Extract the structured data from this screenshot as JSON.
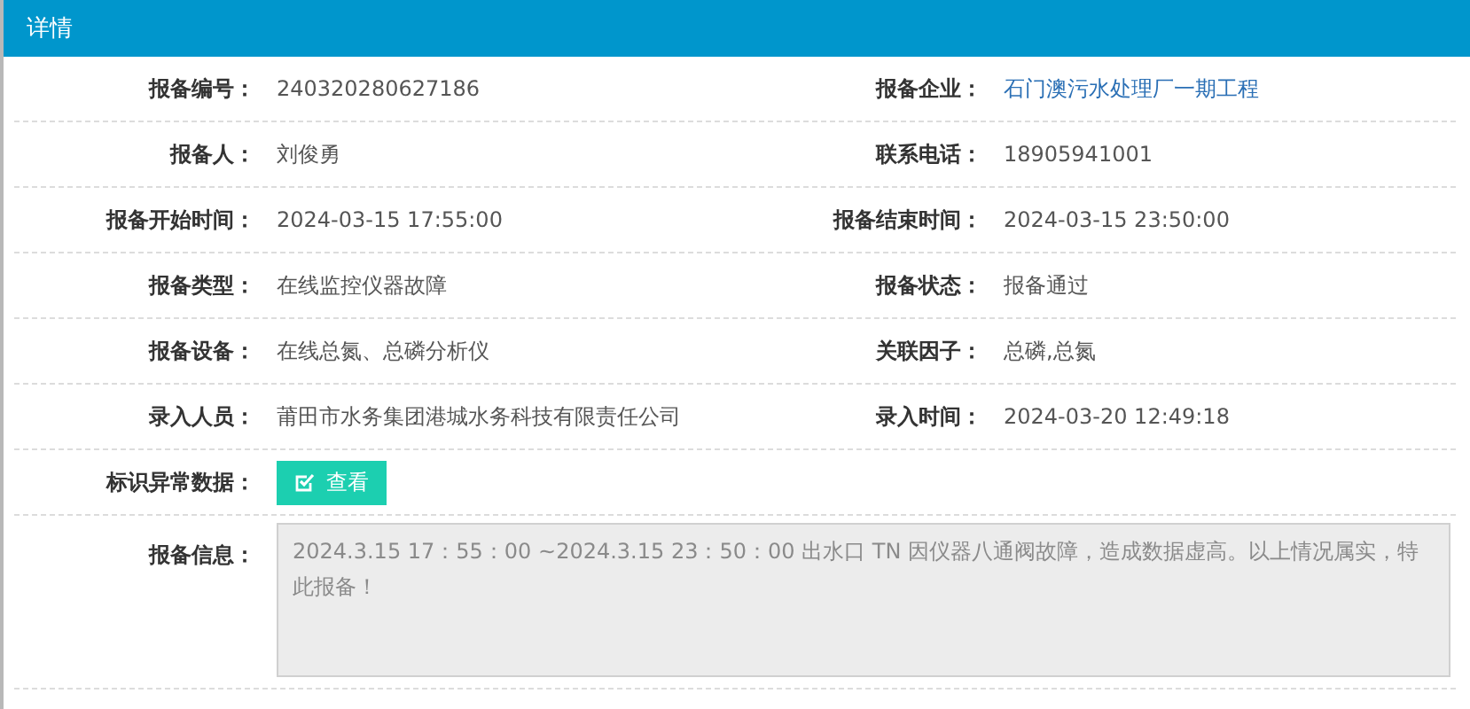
{
  "window": {
    "title": "详情"
  },
  "rows": [
    [
      {
        "label": "报备编号：",
        "value": "240320280627186",
        "kind": "text"
      },
      {
        "label": "报备企业：",
        "value": "石门澳污水处理厂一期工程",
        "kind": "link"
      }
    ],
    [
      {
        "label": "报备人：",
        "value": "刘俊勇",
        "kind": "text"
      },
      {
        "label": "联系电话：",
        "value": "18905941001",
        "kind": "text"
      }
    ],
    [
      {
        "label": "报备开始时间：",
        "value": "2024-03-15 17:55:00",
        "kind": "text"
      },
      {
        "label": "报备结束时间：",
        "value": "2024-03-15 23:50:00",
        "kind": "text"
      }
    ],
    [
      {
        "label": "报备类型：",
        "value": "在线监控仪器故障",
        "kind": "text"
      },
      {
        "label": "报备状态：",
        "value": "报备通过",
        "kind": "text"
      }
    ],
    [
      {
        "label": "报备设备：",
        "value": "在线总氮、总磷分析仪",
        "kind": "text"
      },
      {
        "label": "关联因子：",
        "value": "总磷,总氮",
        "kind": "text"
      }
    ],
    [
      {
        "label": "录入人员：",
        "value": "莆田市水务集团港城水务科技有限责任公司",
        "kind": "text"
      },
      {
        "label": "录入时间：",
        "value": "2024-03-20 12:49:18",
        "kind": "text"
      }
    ]
  ],
  "abnormal": {
    "label": "标识异常数据：",
    "button": "查看"
  },
  "info": {
    "label": "报备信息：",
    "value": "2024.3.15 17：55：00 ~2024.3.15 23：50：00 出水口 TN 因仪器八通阀故障，造成数据虚高。以上情况属实，特此报备！"
  }
}
